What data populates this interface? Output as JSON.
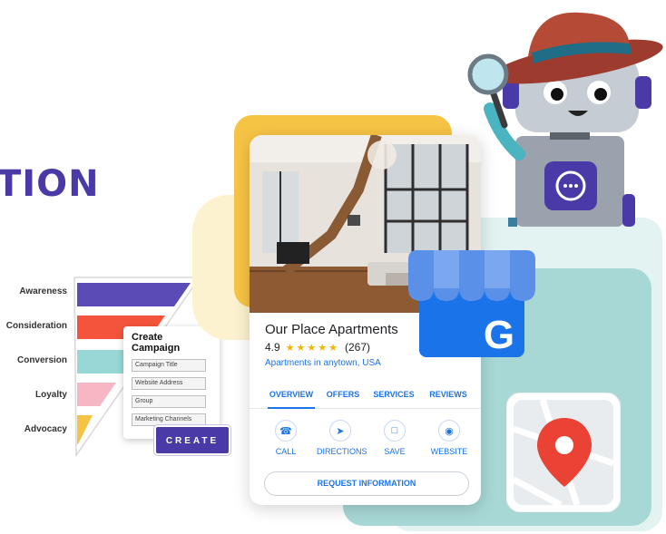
{
  "hero": {
    "title_fragment": "TION"
  },
  "funnel": {
    "stages": [
      {
        "label": "Awareness",
        "color": "#5b4bb7"
      },
      {
        "label": "Consideration",
        "color": "#f4543c"
      },
      {
        "label": "Conversion",
        "color": "#97d8d6"
      },
      {
        "label": "Loyalty",
        "color": "#f6b6c4"
      },
      {
        "label": "Advocacy",
        "color": "#f6c445"
      }
    ]
  },
  "campaign": {
    "title": "Create Campaign",
    "fields": [
      "Campaign Title",
      "Website Address",
      "Group",
      "Marketing Channels"
    ],
    "button": "CREATE"
  },
  "listing": {
    "name": "Our Place Apartments",
    "rating": "4.9",
    "stars": "★★★★★",
    "reviews": "(267)",
    "location": "Apartments in anytown, USA",
    "tabs": [
      "OVERVIEW",
      "OFFERS",
      "SERVICES",
      "REVIEWS"
    ],
    "actions": [
      {
        "label": "CALL",
        "icon": "phone-icon"
      },
      {
        "label": "DIRECTIONS",
        "icon": "directions-icon"
      },
      {
        "label": "SAVE",
        "icon": "bookmark-icon"
      },
      {
        "label": "WEBSITE",
        "icon": "globe-icon"
      }
    ],
    "request_button": "REQUEST INFORMATION"
  },
  "google_business": {
    "letter": "G"
  },
  "colors": {
    "brand_purple": "#4a3aa7",
    "google_blue": "#1a73e8",
    "accent_yellow": "#f6c445",
    "teal": "#a8d8d6",
    "map_pin": "#ea4335"
  }
}
